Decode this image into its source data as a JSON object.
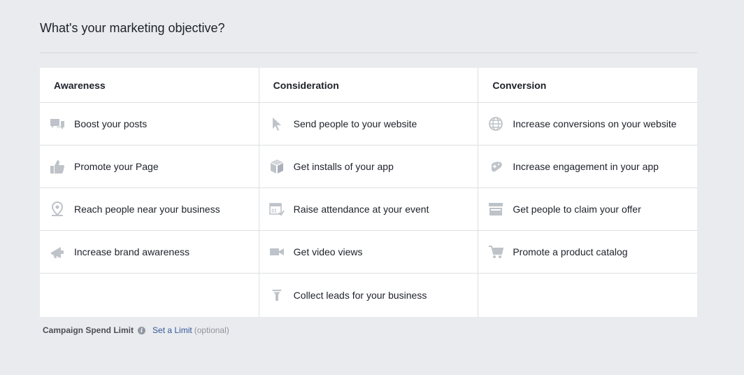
{
  "page": {
    "title": "What's your marketing objective?"
  },
  "columns": [
    {
      "header": "Awareness",
      "items": [
        {
          "label": "Boost your posts",
          "icon": "speech-bubbles-icon"
        },
        {
          "label": "Promote your Page",
          "icon": "thumbs-up-icon"
        },
        {
          "label": "Reach people near your business",
          "icon": "map-pin-icon"
        },
        {
          "label": "Increase brand awareness",
          "icon": "megaphone-icon"
        }
      ]
    },
    {
      "header": "Consideration",
      "items": [
        {
          "label": "Send people to your website",
          "icon": "cursor-icon"
        },
        {
          "label": "Get installs of your app",
          "icon": "box-icon"
        },
        {
          "label": "Raise attendance at your event",
          "icon": "calendar-icon",
          "icon_text": "31"
        },
        {
          "label": "Get video views",
          "icon": "video-camera-icon"
        },
        {
          "label": "Collect leads for your business",
          "icon": "funnel-icon"
        }
      ]
    },
    {
      "header": "Conversion",
      "items": [
        {
          "label": "Increase conversions on your website",
          "icon": "globe-icon"
        },
        {
          "label": "Increase engagement in your app",
          "icon": "game-controller-icon"
        },
        {
          "label": "Get people to claim your offer",
          "icon": "storefront-icon"
        },
        {
          "label": "Promote a product catalog",
          "icon": "shopping-cart-icon"
        }
      ]
    }
  ],
  "footer": {
    "limit_label": "Campaign Spend Limit",
    "info_icon": "info-icon",
    "info_glyph": "i",
    "link_label": "Set a Limit",
    "optional_text": "(optional)"
  },
  "colors": {
    "background": "#e9ebee",
    "icon": "#bec3c9",
    "link": "#365899"
  }
}
